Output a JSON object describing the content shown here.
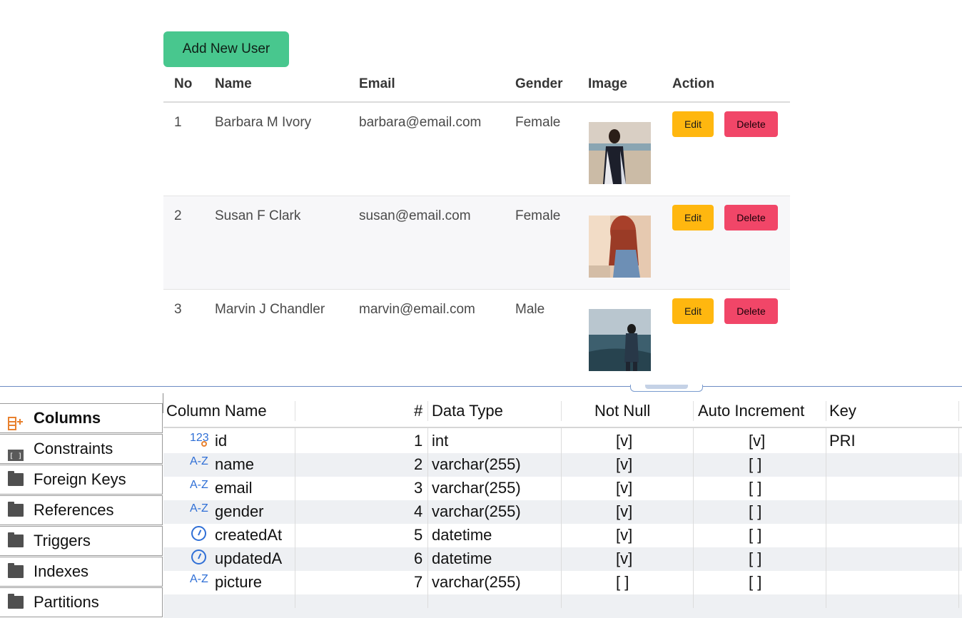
{
  "users_panel": {
    "add_button": "Add New User",
    "headers": [
      "No",
      "Name",
      "Email",
      "Gender",
      "Image",
      "Action"
    ],
    "edit_label": "Edit",
    "delete_label": "Delete",
    "rows": [
      {
        "no": "1",
        "name": "Barbara M Ivory",
        "email": "barbara@email.com",
        "gender": "Female",
        "image": "woman-on-beach-photo"
      },
      {
        "no": "2",
        "name": "Susan F Clark",
        "email": "susan@email.com",
        "gender": "Female",
        "image": "red-haired-woman-photo"
      },
      {
        "no": "3",
        "name": "Marvin J Chandler",
        "email": "marvin@email.com",
        "gender": "Male",
        "image": "man-at-sea-view-photo"
      }
    ],
    "colors": {
      "add": "#48c78e",
      "edit": "#ffb70f",
      "delete": "#f14668"
    }
  },
  "db_panel": {
    "tabs": [
      {
        "label": "Columns",
        "icon": "columns-add-icon",
        "active": true
      },
      {
        "label": "Constraints",
        "icon": "constraints-icon",
        "active": false
      },
      {
        "label": "Foreign Keys",
        "icon": "folder-icon",
        "active": false
      },
      {
        "label": "References",
        "icon": "folder-icon",
        "active": false
      },
      {
        "label": "Triggers",
        "icon": "folder-icon",
        "active": false
      },
      {
        "label": "Indexes",
        "icon": "folder-icon",
        "active": false
      },
      {
        "label": "Partitions",
        "icon": "folder-icon",
        "active": false
      }
    ],
    "grid_headers": {
      "column_name": "Column Name",
      "num": "#",
      "data_type": "Data Type",
      "not_null": "Not Null",
      "auto_increment": "Auto Increment",
      "key": "Key"
    },
    "columns": [
      {
        "type_icon": "123",
        "name": "id",
        "num": "1",
        "data_type": "int",
        "not_null": "[v]",
        "auto_increment": "[v]",
        "key": "PRI"
      },
      {
        "type_icon": "A-Z",
        "name": "name",
        "num": "2",
        "data_type": "varchar(255)",
        "not_null": "[v]",
        "auto_increment": "[ ]",
        "key": ""
      },
      {
        "type_icon": "A-Z",
        "name": "email",
        "num": "3",
        "data_type": "varchar(255)",
        "not_null": "[v]",
        "auto_increment": "[ ]",
        "key": ""
      },
      {
        "type_icon": "A-Z",
        "name": "gender",
        "num": "4",
        "data_type": "varchar(255)",
        "not_null": "[v]",
        "auto_increment": "[ ]",
        "key": ""
      },
      {
        "type_icon": "clock",
        "name": "createdAt",
        "num": "5",
        "data_type": "datetime",
        "not_null": "[v]",
        "auto_increment": "[ ]",
        "key": ""
      },
      {
        "type_icon": "clock",
        "name": "updatedA",
        "num": "6",
        "data_type": "datetime",
        "not_null": "[v]",
        "auto_increment": "[ ]",
        "key": ""
      },
      {
        "type_icon": "A-Z",
        "name": "picture",
        "num": "7",
        "data_type": "varchar(255)",
        "not_null": "[ ]",
        "auto_increment": "[ ]",
        "key": ""
      }
    ]
  }
}
